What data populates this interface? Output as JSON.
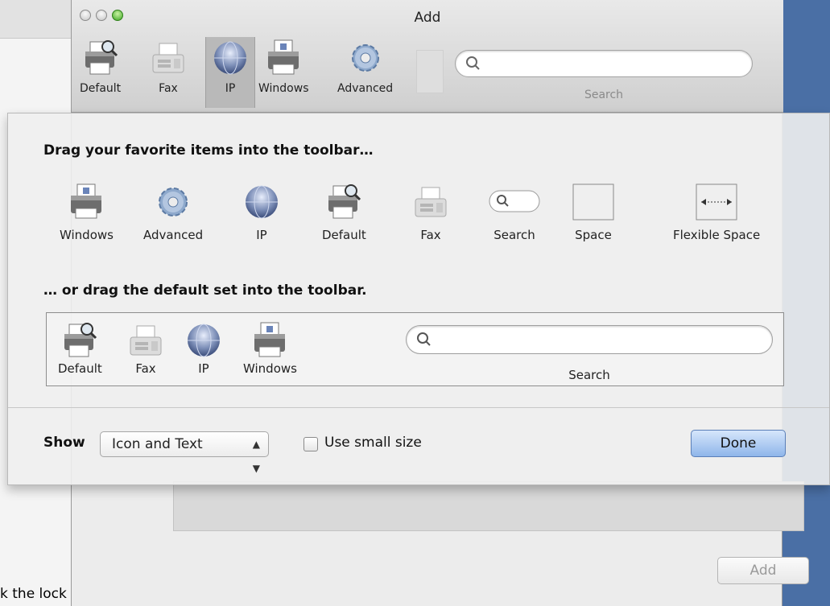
{
  "window": {
    "title": "Add"
  },
  "toolbar": {
    "items": [
      {
        "label": "Default",
        "icon": "printer-magnifier-icon"
      },
      {
        "label": "Fax",
        "icon": "fax-icon"
      },
      {
        "label": "IP",
        "icon": "globe-icon"
      },
      {
        "label": "Windows",
        "icon": "windows-printer-icon"
      },
      {
        "label": "Advanced",
        "icon": "gear-icon"
      }
    ],
    "search_label": "Search",
    "search_placeholder": ""
  },
  "sheet": {
    "heading": "Drag your favorite items into the toolbar…",
    "palette": [
      {
        "label": "Windows",
        "icon": "windows-printer-icon"
      },
      {
        "label": "Advanced",
        "icon": "gear-icon"
      },
      {
        "label": "IP",
        "icon": "globe-icon"
      },
      {
        "label": "Default",
        "icon": "printer-magnifier-icon"
      },
      {
        "label": "Fax",
        "icon": "fax-icon"
      },
      {
        "label": "Search",
        "icon": "search-field-icon"
      },
      {
        "label": "Space",
        "icon": "space-icon"
      },
      {
        "label": "Flexible Space",
        "icon": "flexible-space-icon"
      }
    ],
    "default_heading": "… or drag the default set into the toolbar.",
    "default_set": [
      {
        "label": "Default",
        "icon": "printer-magnifier-icon"
      },
      {
        "label": "Fax",
        "icon": "fax-icon"
      },
      {
        "label": "IP",
        "icon": "globe-icon"
      },
      {
        "label": "Windows",
        "icon": "windows-printer-icon"
      }
    ],
    "default_search_label": "Search",
    "show_label": "Show",
    "show_value": "Icon and Text",
    "small_size_label": "Use small size",
    "small_size_checked": false,
    "done_label": "Done"
  },
  "background": {
    "add_button_label": "Add",
    "lock_text": "k the lock"
  },
  "colors": {
    "accent": "#8fb6ea",
    "desktop": "#4a6fa5"
  }
}
